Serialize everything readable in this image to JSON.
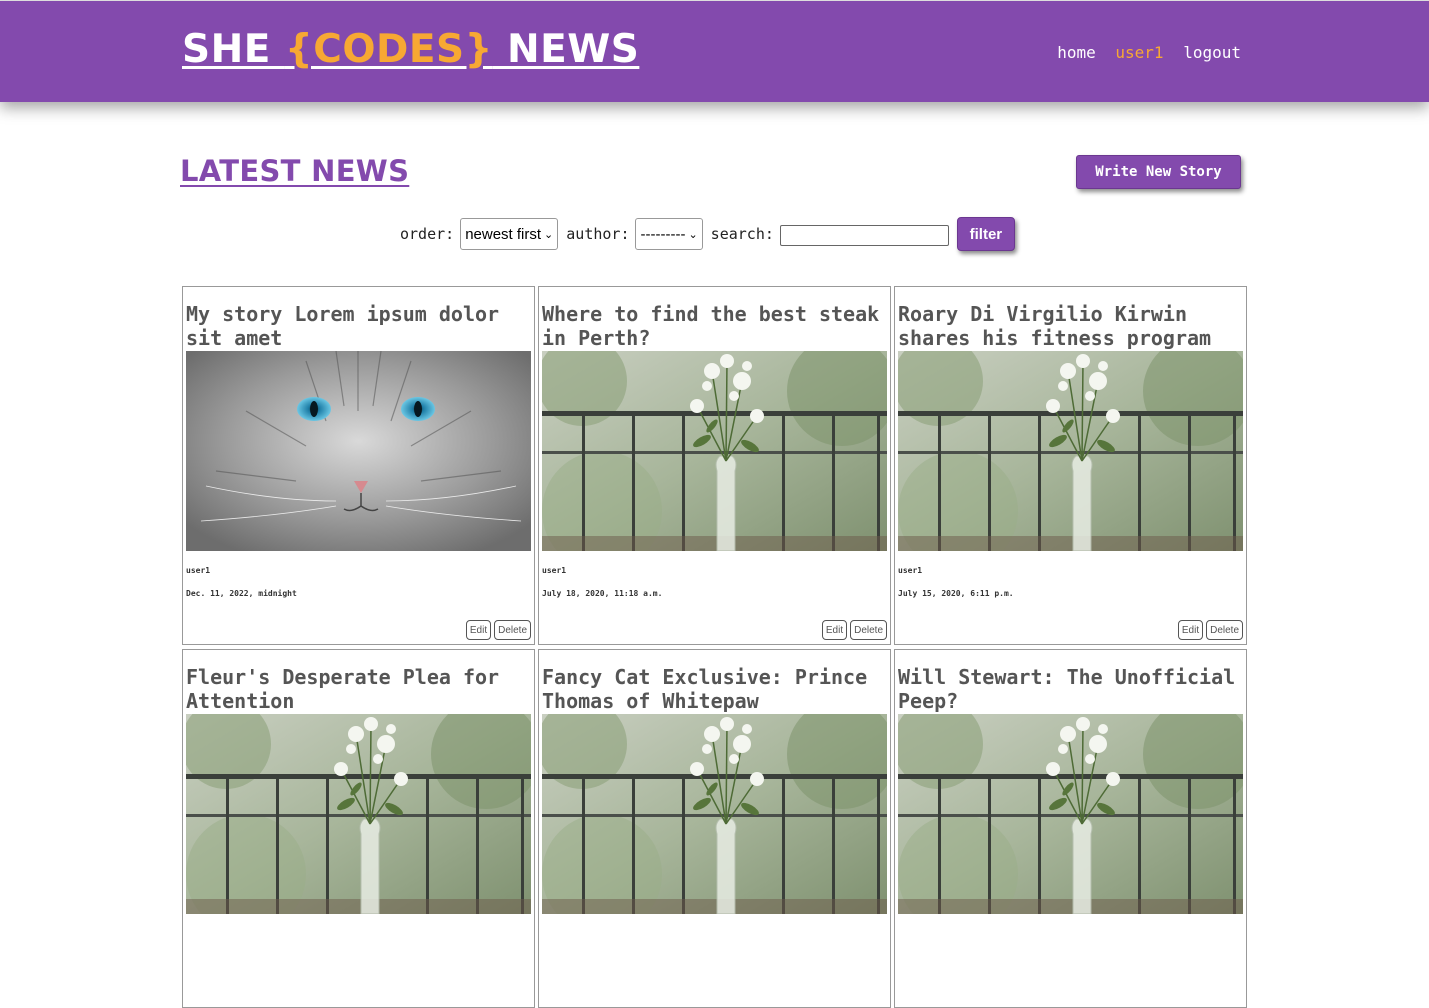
{
  "header": {
    "logo_part1": "SHE ",
    "logo_part2": "{CODES}",
    "logo_part3": " NEWS",
    "nav": [
      {
        "label": "home"
      },
      {
        "label": "user1"
      },
      {
        "label": "logout"
      }
    ]
  },
  "main": {
    "heading": "LATEST NEWS",
    "write_button": "Write New Story"
  },
  "filters": {
    "order_label": "order:",
    "order_value": "newest first",
    "author_label": "author:",
    "author_value": "---------",
    "search_label": "search:",
    "search_value": "",
    "filter_button": "filter"
  },
  "stories": [
    {
      "title": "My story Lorem ipsum dolor sit amet",
      "image": "cat-photo",
      "author": "user1",
      "date": "Dec. 11, 2022, midnight",
      "edit": "Edit",
      "delete": "Delete"
    },
    {
      "title": "Where to find the best steak in Perth?",
      "image": "flower-vase-photo",
      "author": "user1",
      "date": "July 18, 2020, 11:18 a.m.",
      "edit": "Edit",
      "delete": "Delete"
    },
    {
      "title": "Roary Di Virgilio Kirwin shares his fitness program",
      "image": "flower-vase-photo",
      "author": "user1",
      "date": "July 15, 2020, 6:11 p.m.",
      "edit": "Edit",
      "delete": "Delete"
    },
    {
      "title": "Fleur's Desperate Plea for Attention",
      "image": "flower-vase-photo"
    },
    {
      "title": "Fancy Cat Exclusive: Prince Thomas of Whitepaw",
      "image": "flower-vase-photo"
    },
    {
      "title": "Will Stewart: The Unofficial Peep?",
      "image": "flower-vase-photo"
    }
  ],
  "colors": {
    "brand_purple": "#834aad",
    "accent_orange": "#f7a833"
  }
}
